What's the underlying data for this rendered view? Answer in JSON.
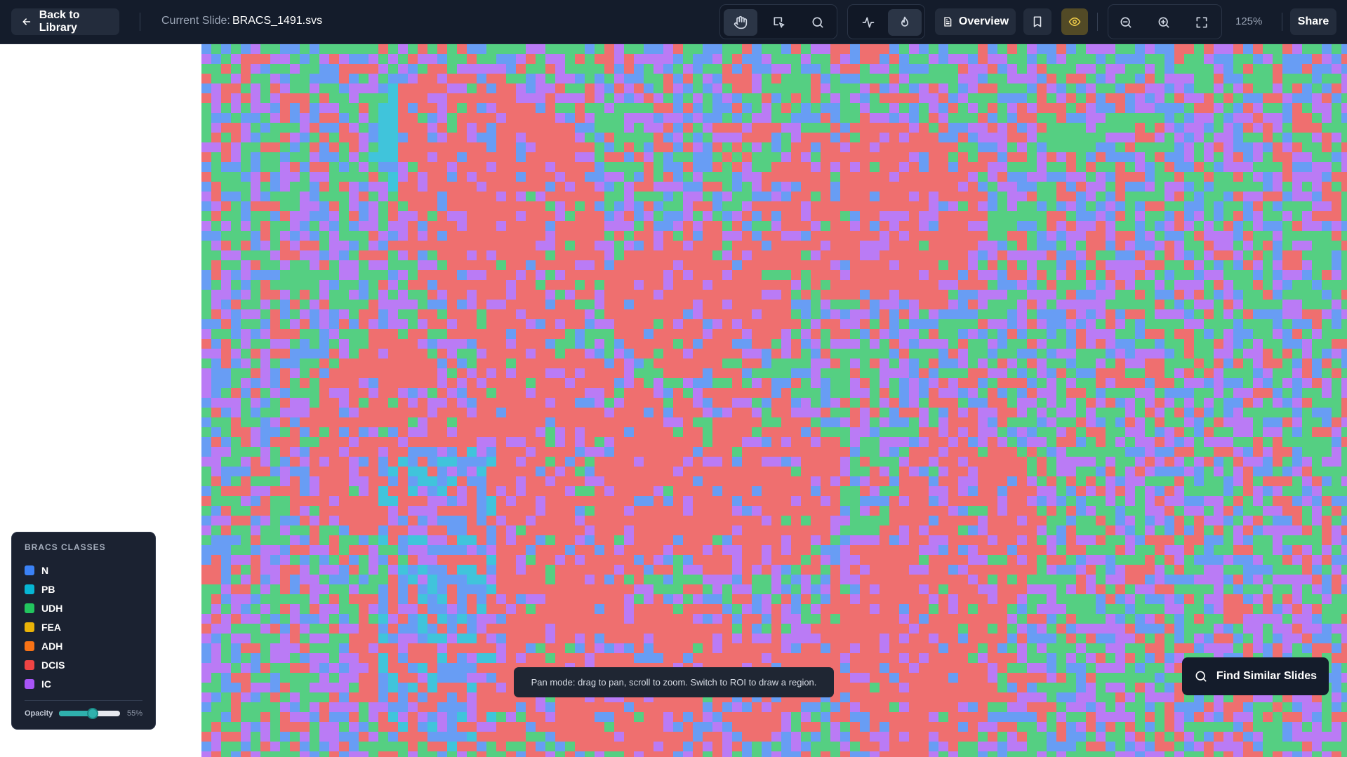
{
  "header": {
    "back_label": "Back to Library",
    "slide_label": "Current Slide:",
    "slide_name": "BRACS_1491.svs",
    "overview_label": "Overview",
    "zoom_level": "125%",
    "share_label": "Share"
  },
  "toolbar": {
    "tools": [
      {
        "name": "pan-tool",
        "icon": "hand-icon",
        "active": true
      },
      {
        "name": "roi-tool",
        "icon": "roi-select-icon",
        "active": false
      },
      {
        "name": "search-tool",
        "icon": "search-icon",
        "active": false
      },
      {
        "name": "analysis-tool",
        "icon": "activity-icon",
        "active": false
      },
      {
        "name": "heatmap-tool",
        "icon": "flame-icon",
        "active": true
      }
    ]
  },
  "legend": {
    "title": "BRACS CLASSES",
    "classes": [
      {
        "label": "N",
        "color": "#3b82f6"
      },
      {
        "label": "PB",
        "color": "#06b6d4"
      },
      {
        "label": "UDH",
        "color": "#22c55e"
      },
      {
        "label": "FEA",
        "color": "#eab308"
      },
      {
        "label": "ADH",
        "color": "#f97316"
      },
      {
        "label": "DCIS",
        "color": "#ef4444"
      },
      {
        "label": "IC",
        "color": "#a855f7"
      }
    ],
    "opacity_label": "Opacity",
    "opacity_value": "55%",
    "opacity_fraction": 0.55
  },
  "toast": {
    "message": "Pan mode: drag to pan, scroll to zoom. Switch to ROI to draw a region."
  },
  "find_similar": {
    "label": "Find Similar Slides"
  },
  "colors": {
    "topbar": "#141c2b",
    "slide_background": "#f1f0f1",
    "heat_eye_active": "#f3cf4a"
  }
}
